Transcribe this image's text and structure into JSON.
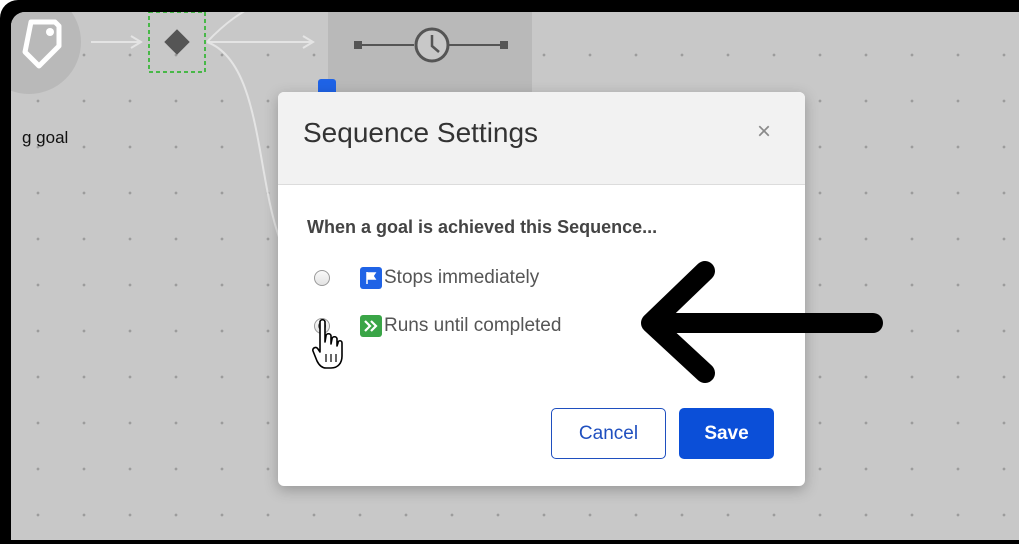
{
  "canvas": {
    "goal_label": "g goal"
  },
  "dialog": {
    "title": "Sequence Settings",
    "close_label": "×",
    "question": "When a goal is achieved this Sequence...",
    "options": [
      {
        "label": "Stops immediately",
        "selected": false,
        "icon": "flag-icon",
        "icon_color": "#1f63e6"
      },
      {
        "label": "Runs until completed",
        "selected": true,
        "icon": "double-chevron-right-icon",
        "icon_color": "#3aa547"
      }
    ],
    "cancel_label": "Cancel",
    "save_label": "Save"
  },
  "colors": {
    "primary": "#0b4fd8",
    "canvas_bg": "#c8c8c8",
    "annotation_arrow": "#000000"
  }
}
